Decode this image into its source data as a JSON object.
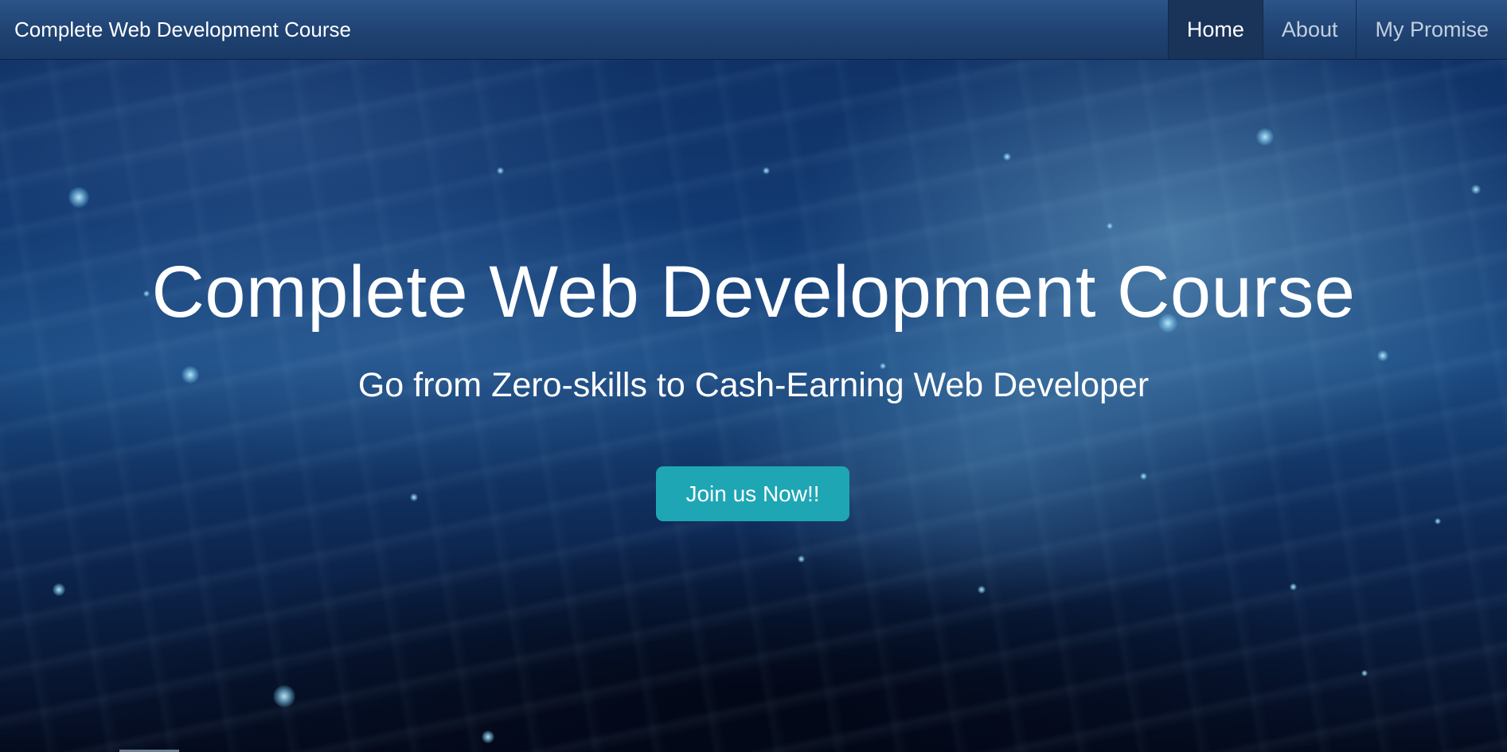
{
  "navbar": {
    "brand": "Complete Web Development Course",
    "links": [
      {
        "label": "Home",
        "active": true
      },
      {
        "label": "About",
        "active": false
      },
      {
        "label": "My Promise",
        "active": false
      }
    ]
  },
  "hero": {
    "title": "Complete Web Development Course",
    "subtitle": "Go from Zero-skills to Cash-Earning Web Developer",
    "cta_label": "Join us Now!!",
    "background_image": "blue-particle-space-background"
  },
  "colors": {
    "navbar": "#1f4272",
    "nav_active": "#1a3358",
    "cta": "#1ea6b5",
    "text": "#ffffff"
  }
}
